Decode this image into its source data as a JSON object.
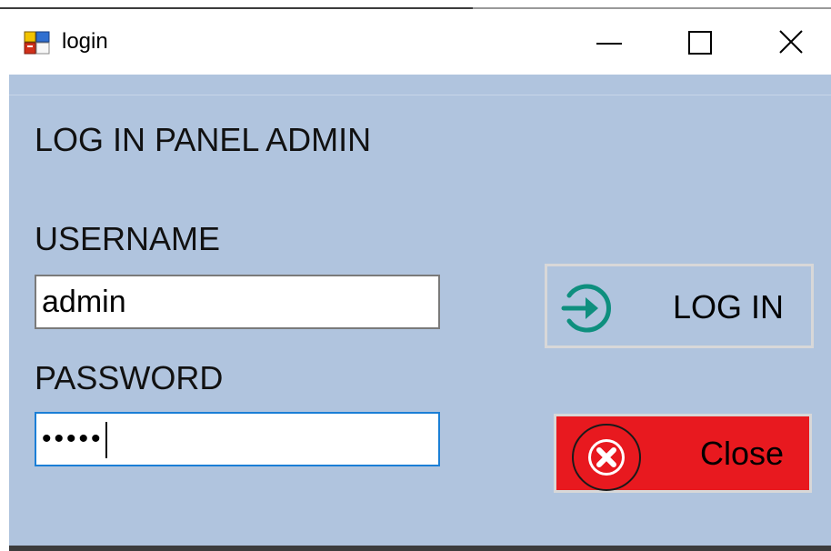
{
  "window": {
    "title": "login",
    "controls": {
      "minimize": "minimize-icon",
      "maximize": "maximize-icon",
      "close": "close-icon"
    },
    "icon": "app-icon"
  },
  "form": {
    "heading": "LOG IN PANEL ADMIN",
    "username_label": "USERNAME",
    "username_value": "admin",
    "password_label": "PASSWORD",
    "password_value": "•••••"
  },
  "buttons": {
    "login_label": "LOG IN",
    "login_icon": "login-arrow-icon",
    "close_label": "Close",
    "close_icon": "x-circle-icon"
  },
  "colors": {
    "client_background": "#B0C4DE",
    "close_button": "#E8191F",
    "login_icon": "#0E8F7E",
    "focus_border": "#1B7FD6"
  }
}
